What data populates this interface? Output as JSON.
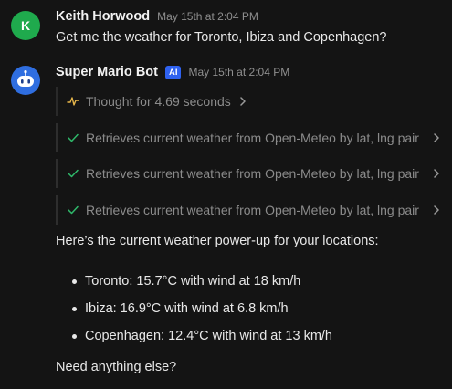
{
  "user_message": {
    "avatar_letter": "K",
    "author": "Keith Horwood",
    "timestamp": "May 15th at 2:04 PM",
    "text": "Get me the weather for Toronto, Ibiza and Copenhagen?"
  },
  "bot_message": {
    "author": "Super Mario Bot",
    "badge": "AI",
    "timestamp": "May 15th at 2:04 PM",
    "thought": {
      "label": "Thought for 4.69 seconds",
      "icon": "activity-icon"
    },
    "tool_calls": [
      {
        "label": "Retrieves current weather from Open-Meteo by lat, lng pair",
        "status": "done"
      },
      {
        "label": "Retrieves current weather from Open-Meteo by lat, lng pair",
        "status": "done"
      },
      {
        "label": "Retrieves current weather from Open-Meteo by lat, lng pair",
        "status": "done"
      }
    ],
    "intro": "Here’s the current weather power-up for your locations:",
    "bullets": [
      "Toronto: 15.7°C with wind at 18 km/h",
      "Ibiza: 16.9°C with wind at 6.8 km/h",
      "Copenhagen: 12.4°C with wind at 13 km/h"
    ],
    "closing": "Need anything else?"
  },
  "colors": {
    "background": "#141414",
    "user_avatar": "#1faa4d",
    "bot_avatar": "#2f6ee0",
    "ai_badge": "#2f62f0",
    "thought_icon": "#e5b54a",
    "check_icon": "#2fb86a"
  }
}
